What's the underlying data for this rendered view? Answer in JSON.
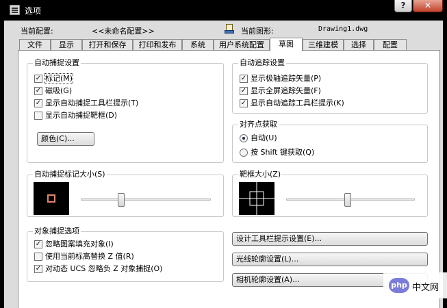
{
  "window": {
    "title": "选项"
  },
  "title_controls": {
    "help": "?",
    "close": "✕"
  },
  "config": {
    "current_config_label": "当前配置:",
    "current_config_value": "<<未命名配置>>",
    "current_drawing_label": "当前图形:",
    "current_drawing_value": "Drawing1.dwg"
  },
  "tabs": [
    {
      "label": "文件",
      "active": false
    },
    {
      "label": "显示",
      "active": false
    },
    {
      "label": "打开和保存",
      "active": false
    },
    {
      "label": "打印和发布",
      "active": false
    },
    {
      "label": "系统",
      "active": false
    },
    {
      "label": "用户系统配置",
      "active": false
    },
    {
      "label": "草图",
      "active": true
    },
    {
      "label": "三维建模",
      "active": false
    },
    {
      "label": "选择",
      "active": false
    },
    {
      "label": "配置",
      "active": false
    }
  ],
  "autosnap": {
    "title": "自动捕捉设置",
    "items": [
      {
        "label": "标记(M)",
        "checked": true
      },
      {
        "label": "磁吸(G)",
        "checked": true
      },
      {
        "label": "显示自动捕捉工具栏提示(T)",
        "checked": true
      },
      {
        "label": "显示自动捕捉靶框(D)",
        "checked": false
      }
    ],
    "color_button": "颜色(C)..."
  },
  "autotrack": {
    "title": "自动追踪设置",
    "items": [
      {
        "label": "显示极轴追踪矢量(P)",
        "checked": true
      },
      {
        "label": "显示全屏追踪矢量(F)",
        "checked": true
      },
      {
        "label": "显示自动追踪工具栏提示(K)",
        "checked": true
      }
    ]
  },
  "alignment": {
    "title": "对齐点获取",
    "options": [
      {
        "label": "自动(U)",
        "selected": true
      },
      {
        "label": "按 Shift 键获取(Q)",
        "selected": false
      }
    ]
  },
  "marker_size": {
    "title": "自动捕捉标记大小(S)",
    "slider_fraction": 0.3,
    "marker_color": "#e0876a"
  },
  "aperture_size": {
    "title": "靶框大小(Z)",
    "slider_fraction": 0.48
  },
  "object_snap": {
    "title": "对象捕捉选项",
    "items": [
      {
        "label": "忽略图案填充对象(I)",
        "checked": true
      },
      {
        "label": "使用当前标高替换 Z 值(R)",
        "checked": false
      },
      {
        "label": "对动态 UCS 忽略负 Z 对象捕捉(O)",
        "checked": true
      }
    ]
  },
  "right_buttons": {
    "tooltip_settings": "设计工具栏提示设置(E)...",
    "lightglyph_settings": "光线轮廓设置(L)...",
    "camera_settings": "相机轮廓设置(A)..."
  },
  "watermark": {
    "icon_text": "php",
    "text": "中文网"
  },
  "colors": {
    "titlebar": "#000000",
    "dialog_bg": "#dcdcdc",
    "panel_bg": "#ffffff",
    "close_button": "#c2412a"
  }
}
